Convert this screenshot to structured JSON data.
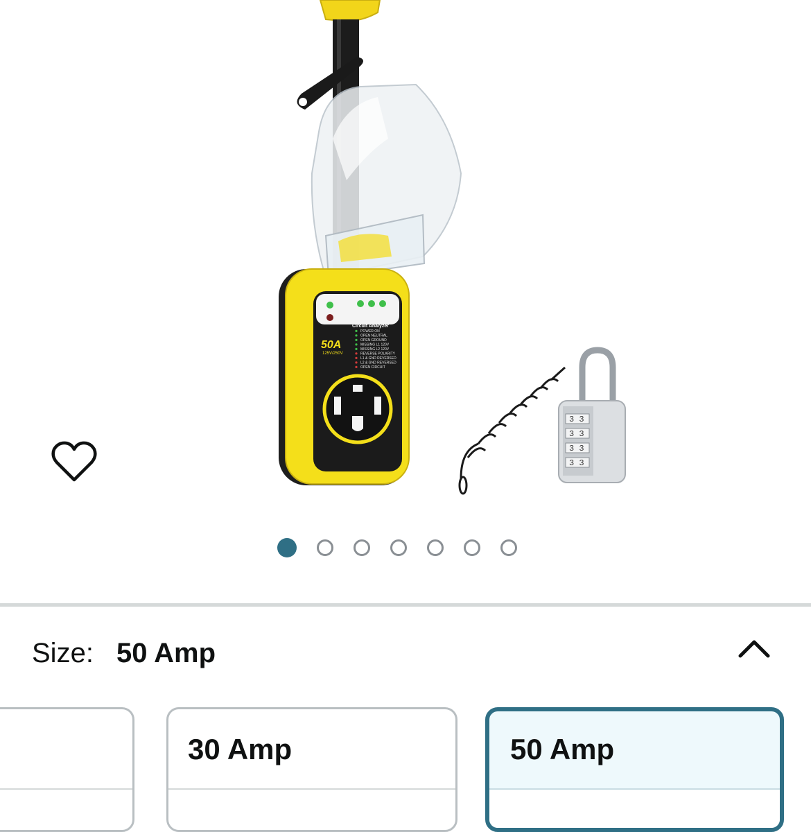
{
  "gallery": {
    "image_index_total": 7,
    "active_index": 0,
    "lcd": {
      "amp_label": "50A",
      "voltage_label": "125V/250V",
      "panel_title": "Circuit Analyzer",
      "status_lines": [
        "POWER ON",
        "OPEN NEUTRAL",
        "OPEN GROUND",
        "MISSING L1 120V",
        "MISSING L2 120V",
        "REVERSE POLARITY",
        "L1 & GND REVERSED",
        "L2 & GND REVERSED",
        "OPEN CIRCUIT"
      ]
    },
    "lock_digits": [
      "3",
      "3",
      "3",
      "3"
    ]
  },
  "size_selector": {
    "label": "Size:",
    "selected_value": "50 Amp",
    "options": [
      {
        "label": ""
      },
      {
        "label": "30 Amp"
      },
      {
        "label": "50 Amp"
      }
    ]
  },
  "colors": {
    "accent": "#2f6f85",
    "selected_bg": "#eef9fc",
    "product_yellow": "#f4df1a"
  }
}
